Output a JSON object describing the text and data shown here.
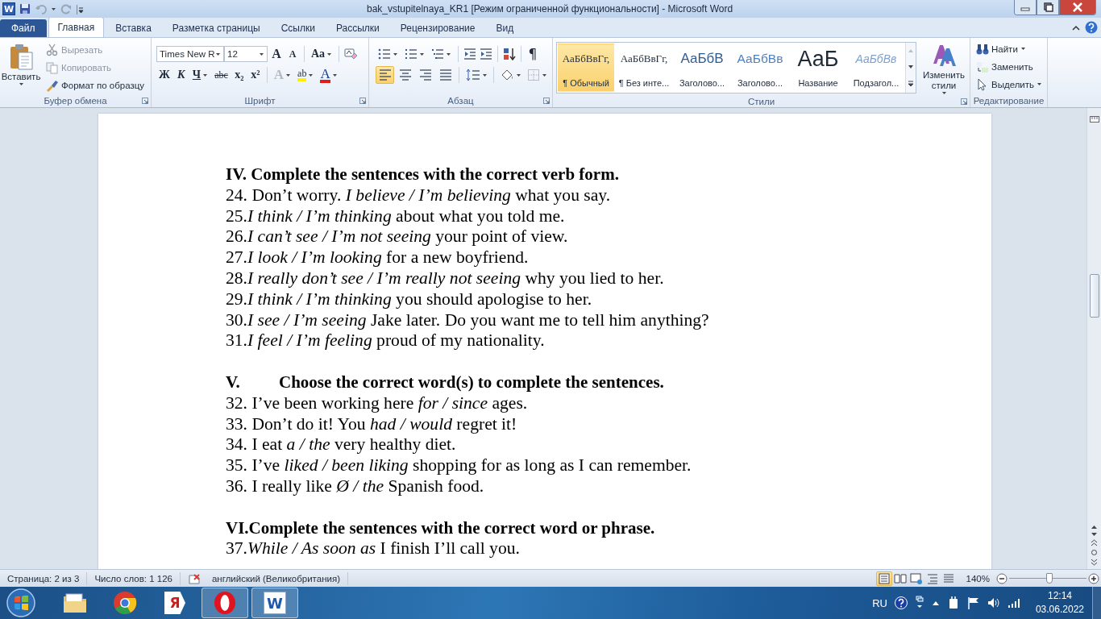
{
  "window": {
    "title": "bak_vstupitelnaya_KR1 [Режим ограниченной функциональности]  -  Microsoft Word",
    "app_glyph": "W"
  },
  "tabs": [
    {
      "label": "Файл",
      "kind": "file",
      "selected": false
    },
    {
      "label": "Главная",
      "kind": "tab",
      "selected": true
    },
    {
      "label": "Вставка",
      "kind": "tab",
      "selected": false
    },
    {
      "label": "Разметка страницы",
      "kind": "tab",
      "selected": false
    },
    {
      "label": "Ссылки",
      "kind": "tab",
      "selected": false
    },
    {
      "label": "Рассылки",
      "kind": "tab",
      "selected": false
    },
    {
      "label": "Рецензирование",
      "kind": "tab",
      "selected": false
    },
    {
      "label": "Вид",
      "kind": "tab",
      "selected": false
    }
  ],
  "ribbon": {
    "clipboard": {
      "label": "Буфер обмена",
      "paste": "Вставить",
      "commands": [
        {
          "kind": "cut",
          "label": "Вырезать",
          "disabled": true
        },
        {
          "kind": "copy",
          "label": "Копировать",
          "disabled": true
        },
        {
          "kind": "painter",
          "label": "Формат по образцу",
          "disabled": false
        }
      ]
    },
    "font": {
      "label": "Шрифт",
      "font_name": "Times New R",
      "font_size": "12",
      "buttons_top": [
        {
          "kind": "grow",
          "label": "A"
        },
        {
          "kind": "shrink",
          "label": "A"
        },
        {
          "kind": "case",
          "label": "Aa"
        }
      ],
      "buttons_bottom": [
        {
          "kind": "bold",
          "label": "Ж"
        },
        {
          "kind": "italic",
          "label": "К"
        },
        {
          "kind": "underline",
          "label": "Ч"
        },
        {
          "kind": "strike",
          "label": "abc"
        },
        {
          "kind": "sub",
          "label": "x₂"
        },
        {
          "kind": "sup",
          "label": "x²"
        },
        {
          "kind": "effects",
          "label": "A"
        },
        {
          "kind": "highlight",
          "label": "ab"
        },
        {
          "kind": "color",
          "label": "A"
        }
      ]
    },
    "paragraph": {
      "label": "Абзац",
      "pilcrow": "¶",
      "alignment": [
        {
          "kind": "left",
          "selected": true
        },
        {
          "kind": "center",
          "selected": false
        },
        {
          "kind": "right",
          "selected": false
        },
        {
          "kind": "justify",
          "selected": false
        }
      ]
    },
    "styles": {
      "label": "Стили",
      "change_styles": "Изменить стили",
      "items": [
        {
          "kind": "normal",
          "sample": "АаБбВвГг,",
          "label": "¶ Обычный",
          "selected": true
        },
        {
          "kind": "normal",
          "sample": "АаБбВвГг,",
          "label": "¶ Без инте...",
          "selected": false
        },
        {
          "kind": "heading1",
          "sample": "АаБбВ",
          "label": "Заголово...",
          "selected": false
        },
        {
          "kind": "heading2",
          "sample": "АаБбВв",
          "label": "Заголово...",
          "selected": false
        },
        {
          "kind": "title",
          "sample": "АаБ",
          "label": "Название",
          "selected": false
        },
        {
          "kind": "subtitle",
          "sample": "АаБбВв",
          "label": "Подзагол...",
          "selected": false
        }
      ]
    },
    "editing": {
      "label": "Редактирование",
      "commands": [
        {
          "kind": "find",
          "label": "Найти"
        },
        {
          "kind": "replace",
          "label": "Заменить"
        },
        {
          "kind": "select",
          "label": "Выделить"
        }
      ]
    }
  },
  "document": {
    "sections": [
      {
        "heading": "IV. Complete the sentences with the correct verb form.",
        "items": [
          "24. Don’t worry. *I believe / I’m believing* what you say.",
          "25.*I think / I’m thinking* about what you told me.",
          "26.*I can’t see / I’m not seeing* your point of view.",
          "27.*I look / I’m looking* for a new boyfriend.",
          "28.*I really don’t see / I’m really not seeing* why you lied to her.",
          "29.*I think / I’m thinking* you should apologise to her.",
          "30.*I see / I’m seeing* Jake later. Do you want me to tell him anything?",
          "31.*I feel / I’m feeling* proud of my nationality."
        ]
      },
      {
        "marker": "V.",
        "heading": "Choose the correct word(s) to complete the sentences.",
        "items": [
          "32. I’ve been working here *for / since* ages.",
          "33. Don’t do it! You *had / would* regret it!",
          "34. I eat *a / the* very healthy diet.",
          "35. I’ve *liked / been liking* shopping for as long as I can remember.",
          "36. I really like *Ø / the* Spanish food."
        ]
      },
      {
        "heading": "VI.Complete the sentences with the correct word or phrase.",
        "items": [
          "37.*While / As soon as* I finish I’ll call you."
        ]
      }
    ]
  },
  "status_bar": {
    "page": "Страница: 2 из 3",
    "words": "Число слов: 1 126",
    "language": "английский (Великобритания)",
    "views": [
      {
        "kind": "print",
        "selected": true
      },
      {
        "kind": "read",
        "selected": false
      },
      {
        "kind": "web",
        "selected": false
      },
      {
        "kind": "outline",
        "selected": false
      },
      {
        "kind": "draft",
        "selected": false
      }
    ],
    "zoom": "140%",
    "zoom_slider": {
      "level": 0.52
    }
  },
  "taskbar": {
    "apps": [
      {
        "kind": "explorer",
        "running": false
      },
      {
        "kind": "chrome",
        "running": false
      },
      {
        "kind": "yandex",
        "glyph": "Я",
        "running": false
      },
      {
        "kind": "opera",
        "running": true
      },
      {
        "kind": "word",
        "glyph": "W",
        "running": true
      }
    ],
    "language": "RU",
    "time": "12:14",
    "date": "03.06.2022"
  }
}
